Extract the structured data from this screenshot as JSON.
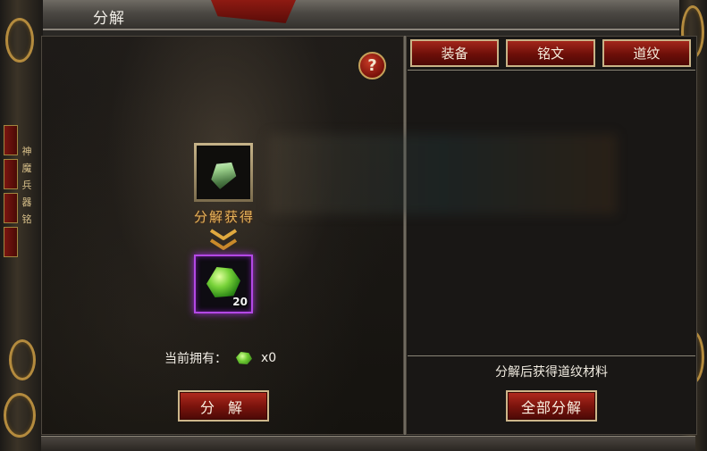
{
  "window": {
    "title": "分解",
    "help_label": "?"
  },
  "sidebar": {
    "vertical_label": "神\n魔\n兵\n器\n铭"
  },
  "tabs": [
    {
      "label": "装备"
    },
    {
      "label": "铭文"
    },
    {
      "label": "道纹"
    }
  ],
  "decompose": {
    "obtain_label": "分解获得",
    "result_count": "20",
    "owned_label": "当前拥有：",
    "owned_count": "x0",
    "decompose_button": "分 解"
  },
  "right_panel": {
    "hint": "分解后获得道纹材料",
    "decompose_all_button": "全部分解"
  },
  "colors": {
    "accent_red": "#8e1a12",
    "gold": "#c8b286",
    "gem_glow": "#b348e5"
  }
}
